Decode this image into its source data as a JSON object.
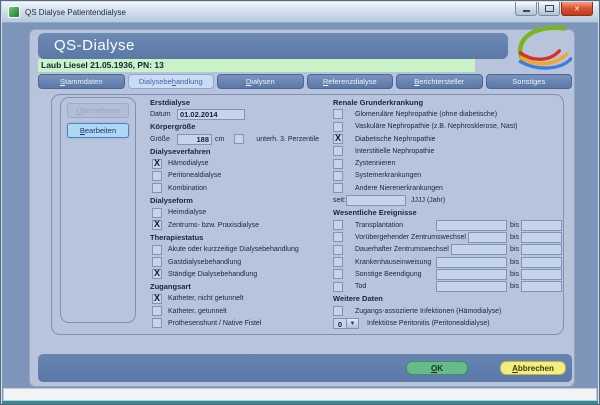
{
  "window": {
    "title": "QS Dialyse Patientendialyse"
  },
  "header": {
    "app_title": "QS-Dialyse"
  },
  "patient_bar": {
    "text": "Laub Liesel 21.05.1936, PN: 13"
  },
  "tabs": [
    {
      "pre": "",
      "key": "S",
      "rest": "tammdaten",
      "active": false
    },
    {
      "pre": "Dialysebe",
      "key": "h",
      "rest": "andlung",
      "active": true
    },
    {
      "pre": "",
      "key": "D",
      "rest": "ialysen",
      "active": false
    },
    {
      "pre": "",
      "key": "R",
      "rest": "eferenzdialyse",
      "active": false
    },
    {
      "pre": "",
      "key": "B",
      "rest": "erichtersteller",
      "active": false
    },
    {
      "pre": "Sonstiges",
      "key": "",
      "rest": "",
      "active": false
    }
  ],
  "actions": {
    "uebernehmen": {
      "pre": "",
      "key": "Ü",
      "rest": "bernehmen",
      "enabled": false
    },
    "bearbeiten": {
      "pre": "",
      "key": "B",
      "rest": "earbeiten",
      "enabled": true
    }
  },
  "form": {
    "left": {
      "sec_erstdialyse": "Erstdialyse",
      "datum_label": "Datum",
      "datum_value": "01.02.2014",
      "sec_koerpergroesse": "Körpergröße",
      "groesse_label": "Größe",
      "groesse_value": "188",
      "groesse_unit": "cm",
      "perzentile_label": "unterh. 3. Perzentile",
      "perzentile_checked": false,
      "sec_dialyseverfahren": "Dialyseverfahren",
      "verfahren": [
        {
          "label": "Hämodialyse",
          "checked": true
        },
        {
          "label": "Peritonealdialyse",
          "checked": false
        },
        {
          "label": "Kombination",
          "checked": false
        }
      ],
      "sec_dialyseform": "Dialyseform",
      "formen": [
        {
          "label": "Heimdialyse",
          "checked": false
        },
        {
          "label": "Zentrums- bzw. Praxisdialyse",
          "checked": true
        }
      ],
      "sec_therapiestatus": "Therapiestatus",
      "status": [
        {
          "label": "Akute oder kurzzeitige Dialysebehandlung",
          "checked": false
        },
        {
          "label": "Gastdialysebehandlung",
          "checked": false
        },
        {
          "label": "Ständige Dialysebehandlung",
          "checked": true
        }
      ],
      "sec_zugangsart": "Zugangsart",
      "zugang": [
        {
          "label": "Katheter, nicht getunnelt",
          "checked": true
        },
        {
          "label": "Katheter, getunnelt",
          "checked": false
        },
        {
          "label": "Prothesenshunt / Native Fistel",
          "checked": false
        }
      ]
    },
    "right": {
      "sec_renale": "Renale Grunderkrankung",
      "renale": [
        {
          "label": "Glomeruläre Nephropathie (ohne diabetische)",
          "checked": false
        },
        {
          "label": "Vaskuläre Nephropathie (z.B. Nephrosklerose, Nast)",
          "checked": false
        },
        {
          "label": "Diabetische Nephropathie",
          "checked": true
        },
        {
          "label": "Interstitielle Nephropathie",
          "checked": false
        },
        {
          "label": "Zystennieren",
          "checked": false
        },
        {
          "label": "Systemerkrankungen",
          "checked": false
        },
        {
          "label": "Andere Nierenerkrankungen",
          "checked": false
        }
      ],
      "seit_label": "seit:",
      "seit_value": "",
      "seit_hint": "JJJJ (Jahr)",
      "sec_ereignisse": "Wesentliche Ereignisse",
      "bis_label": "bis",
      "ereignisse": [
        {
          "label": "Transplantation",
          "checked": false,
          "von": "",
          "bis": ""
        },
        {
          "label": "Vorübergehender Zentrumswechsel",
          "checked": false,
          "von": "",
          "bis": ""
        },
        {
          "label": "Dauerhafter Zentrumswechsel",
          "checked": false,
          "von": "",
          "bis": ""
        },
        {
          "label": "Krankenhauseinweisung",
          "checked": false,
          "von": "",
          "bis": ""
        },
        {
          "label": "Sonstige Beendigung",
          "checked": false,
          "von": "",
          "bis": ""
        },
        {
          "label": "Tod",
          "checked": false,
          "von": "",
          "bis": ""
        }
      ],
      "sec_weitere": "Weitere Daten",
      "infektionen": {
        "label": "Zugangs-assoziierte Infektionen (Hämodialyse)",
        "checked": false
      },
      "peritonitis": {
        "label": "Infektiöse Peritonitis (Peritonealdialyse)",
        "value": "0"
      }
    }
  },
  "footer": {
    "ok": {
      "pre": "",
      "key": "O",
      "rest": "K"
    },
    "abbrechen": {
      "pre": "",
      "key": "A",
      "rest": "bbrechen"
    }
  },
  "colors": {
    "header_blue": "#5b78a6",
    "panel": "#b7c4dc",
    "patient_green": "#c9f3c6",
    "active_tab": "#c9dcf4",
    "ok_green": "#66bb88",
    "cancel_yellow": "#f4ef7d",
    "close_red": "#d9512f",
    "teal_accent": "#2f8d96"
  }
}
